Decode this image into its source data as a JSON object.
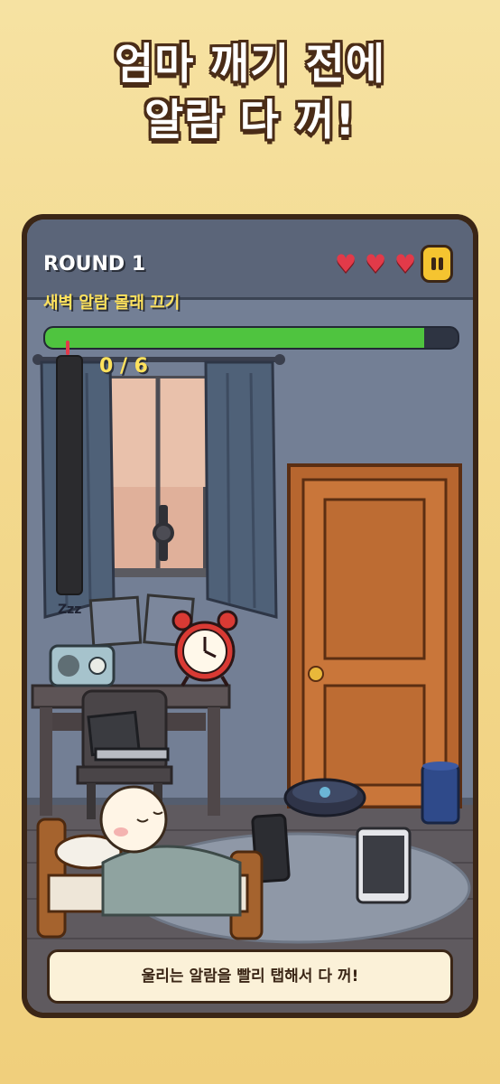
{
  "headline": {
    "line1": "엄마 깨기 전에",
    "line2": "알람 다 꺼!"
  },
  "hud": {
    "round": "ROUND 1",
    "lives": 3,
    "mission": "새벽 알람 몰래 끄기",
    "timer_progress": 0.92,
    "counter": "0 / 6"
  },
  "room": {
    "zzz": "Zzz"
  },
  "tip": "울리는 알람을 빨리 탭해서 다 꺼!",
  "colors": {
    "heart": "#e23a49",
    "pause": "#f5c430",
    "timer": "#4fc43f",
    "mission": "#ffe25c"
  }
}
